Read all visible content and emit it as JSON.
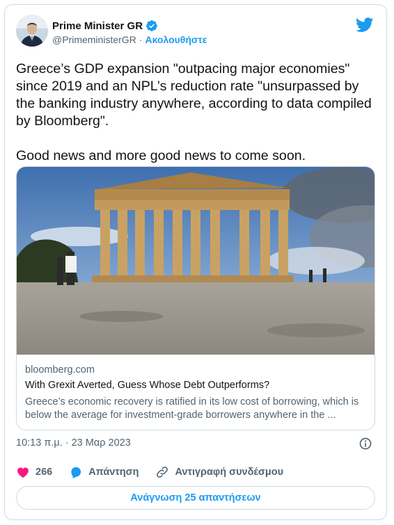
{
  "author": {
    "name": "Prime Minister GR",
    "handle": "@PrimeministerGR",
    "separator": "·",
    "follow_label": "Ακολουθήστε"
  },
  "tweet": {
    "text": "Greece’s GDP expansion \"outpacing major economies\" since 2019 and an NPL’s reduction rate \"unsurpassed by the banking industry anywhere, according to data compiled by Bloomberg\".\n\nGood news and more good news to come soon."
  },
  "link_card": {
    "domain": "bloomberg.com",
    "title": "With Grexit Averted, Guess Whose Debt Outperforms?",
    "description": "Greece’s economic recovery is ratified in its low cost of borrowing, which is below the average for investment-grade borrowers anywhere in the ..."
  },
  "timestamp": "10:13 π.μ. · 23 Μαρ 2023",
  "actions": {
    "like_count": "266",
    "reply_label": "Απάντηση",
    "copy_link_label": "Αντιγραφή συνδέσμου"
  },
  "read_replies_label": "Ανάγνωση 25 απαντήσεων",
  "colors": {
    "accent": "#1d9bf0",
    "like": "#f91880",
    "secondary_text": "#536471",
    "border": "#cfd9de"
  },
  "icons": [
    "verified-badge-icon",
    "twitter-bird-icon",
    "info-icon",
    "heart-icon",
    "reply-icon",
    "link-icon"
  ]
}
